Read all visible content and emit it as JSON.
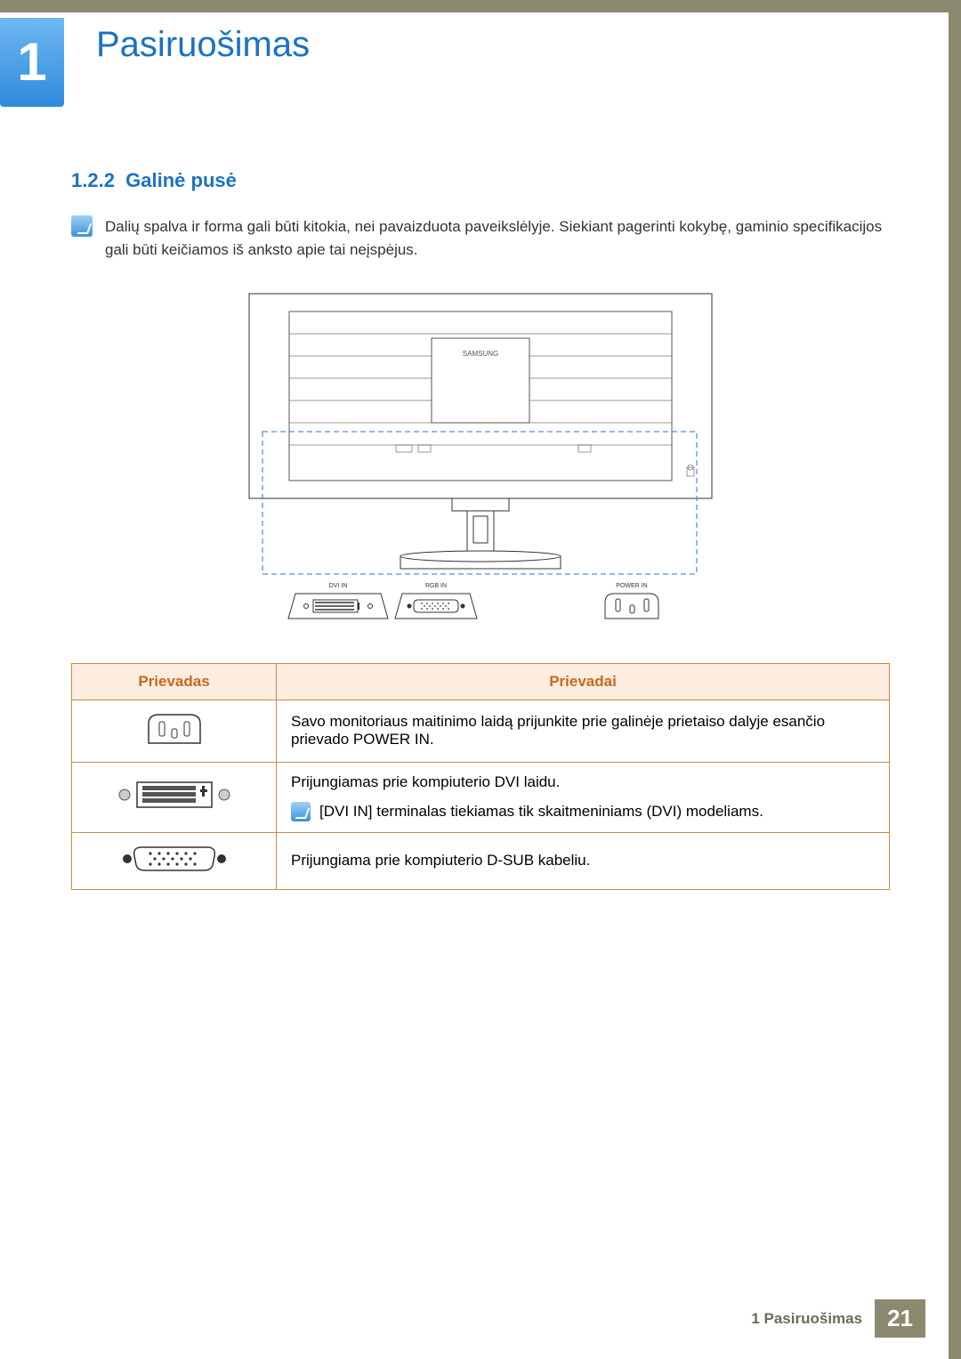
{
  "chapter": {
    "number": "1",
    "title": "Pasiruošimas"
  },
  "section": {
    "number": "1.2.2",
    "title": "Galinė pusė"
  },
  "note": "Dalių spalva ir forma gali būti kitokia, nei pavaizduota paveikslėlyje. Siekiant pagerinti kokybę, gaminio specifikacijos gali būti keičiamos iš anksto apie tai neįspėjus.",
  "diagram": {
    "brand": "SAMSUNG",
    "port_labels": {
      "dvi": "DVI IN",
      "rgb": "RGB IN",
      "power": "POWER IN"
    }
  },
  "table": {
    "headers": {
      "port": "Prievadas",
      "ports": "Prievadai"
    },
    "rows": [
      {
        "icon": "power",
        "desc": "Savo monitoriaus maitinimo laidą prijunkite prie galinėje prietaiso dalyje esančio prievado POWER IN."
      },
      {
        "icon": "dvi",
        "desc": "Prijungiamas prie kompiuterio DVI laidu.",
        "note": "[DVI IN] terminalas tiekiamas tik skaitmeniniams (DVI) modeliams."
      },
      {
        "icon": "vga",
        "desc": "Prijungiama prie kompiuterio D-SUB kabeliu."
      }
    ]
  },
  "footer": {
    "label": "1 Pasiruošimas",
    "page": "21"
  }
}
